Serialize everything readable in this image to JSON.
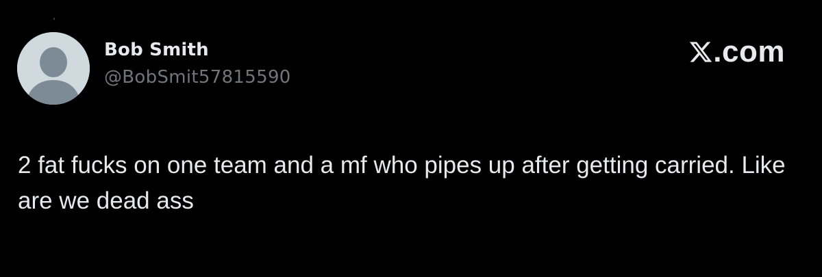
{
  "author": {
    "display_name": "Bob Smith",
    "handle": "@BobSmit57815590",
    "avatar": "default-avatar-icon"
  },
  "brand": {
    "logo": "x-logo-icon",
    "text": ".com"
  },
  "post": {
    "text": "2 fat fucks on one team and a mf who pipes up after getting carried. Like are we dead ass"
  },
  "colors": {
    "background": "#000000",
    "primary_text": "#e7e9ea",
    "secondary_text": "#71767b",
    "avatar_bg": "#cfd9de",
    "avatar_fg": "#7d8b96"
  }
}
